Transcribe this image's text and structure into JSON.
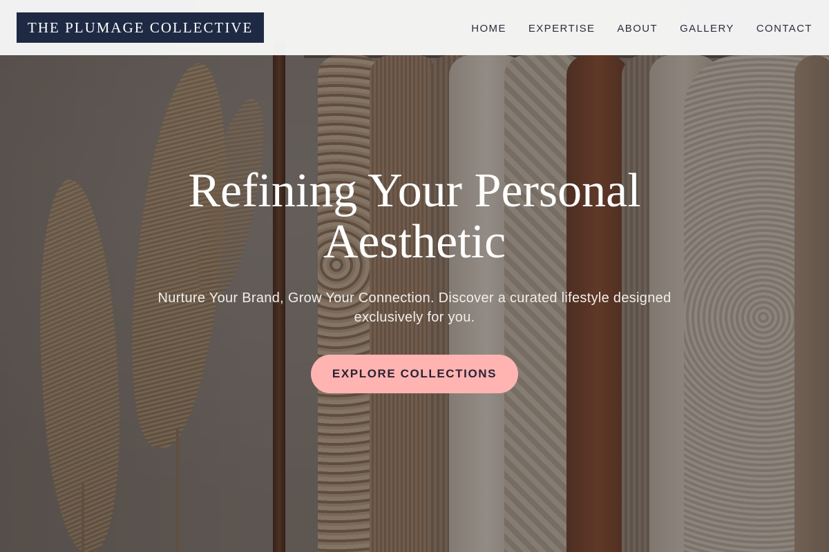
{
  "header": {
    "brand": "THE PLUMAGE COLLECTIVE",
    "nav": [
      {
        "label": "HOME"
      },
      {
        "label": "EXPERTISE"
      },
      {
        "label": "ABOUT"
      },
      {
        "label": "GALLERY"
      },
      {
        "label": "CONTACT"
      }
    ]
  },
  "hero": {
    "title": "Refining Your Personal Aesthetic",
    "subtitle": "Nurture Your Brand, Grow Your Connection. Discover a curated lifestyle designed exclusively for you.",
    "cta_label": "EXPLORE COLLECTIONS"
  },
  "colors": {
    "brand_bg": "#1e2a44",
    "cta_bg": "#ffb4b2",
    "header_bg": "#f7f7f7"
  }
}
